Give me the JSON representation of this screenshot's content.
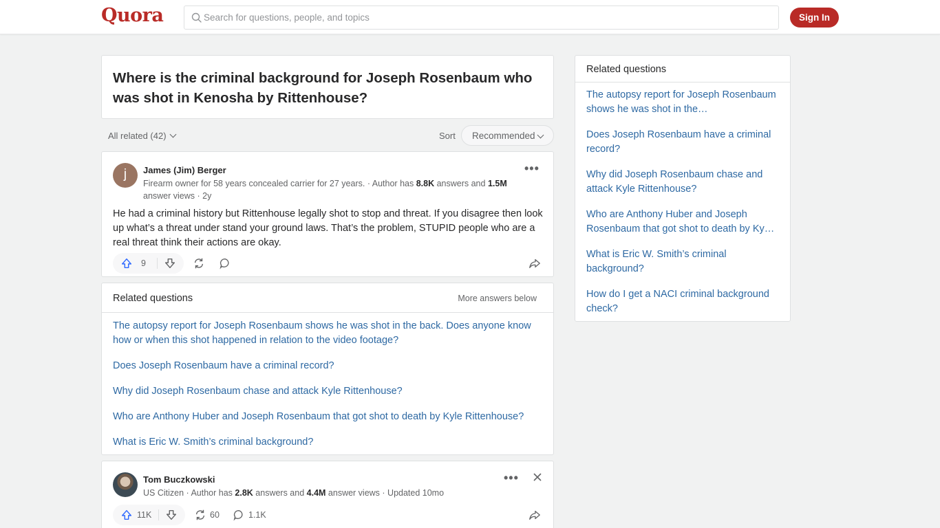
{
  "header": {
    "logo": "Quora",
    "search_placeholder": "Search for questions, people, and topics",
    "signin_label": "Sign In"
  },
  "question": {
    "title": "Where is the criminal background for Joseph Rosenbaum who was shot in Kenosha by Rittenhouse?"
  },
  "controls": {
    "all_related": "All related (42)",
    "sort_label": "Sort",
    "sort_value": "Recommended"
  },
  "answers": [
    {
      "author": "James (Jim) Berger",
      "cred_prefix": "Firearm owner for 58 years concealed carrier for 27 years. · Author has ",
      "answers_count": "8.8K",
      "cred_mid": " answers and ",
      "views_count": "1.5M",
      "cred_suffix": " answer views · 2y",
      "text": "He had a criminal history but Rittenhouse legally shot to stop and threat. If you disagree then look up what’s a threat under stand your ground laws. That’s the problem, STUPID people who are a real threat think their actions are okay.",
      "upvotes": "9",
      "shares": "",
      "comments": ""
    },
    {
      "author": "Tom Buczkowski",
      "cred_prefix": "US Citizen · Author has ",
      "answers_count": "2.8K",
      "cred_mid": " answers and ",
      "views_count": "4.4M",
      "cred_suffix": " answer views · Updated 10mo",
      "upvotes": "11K",
      "shares": "60",
      "comments": "1.1K"
    }
  ],
  "related_inline": {
    "title": "Related questions",
    "more_below": "More answers below",
    "items": [
      "The autopsy report for Joseph Rosenbaum shows he was shot in the back. Does anyone know how or when this shot happened in relation to the video footage?",
      "Does Joseph Rosenbaum have a criminal record?",
      "Why did Joseph Rosenbaum chase and attack Kyle Rittenhouse?",
      "Who are Anthony Huber and Joseph Rosenbaum that got shot to death by Kyle Rittenhouse?",
      "What is Eric W. Smith’s criminal background?"
    ]
  },
  "related_sidebar": {
    "title": "Related questions",
    "items": [
      "The autopsy report for Joseph Rosenbaum shows he was shot in the…",
      "Does Joseph Rosenbaum have a criminal record?",
      "Why did Joseph Rosenbaum chase and attack Kyle Rittenhouse?",
      "Who are Anthony Huber and Joseph Rosenbaum that got shot to death by Ky…",
      "What is Eric W. Smith’s criminal background?",
      "How do I get a NACI criminal background check?"
    ]
  },
  "colors": {
    "brand": "#b92b27",
    "link": "#2e69a3",
    "upvote": "#2e69ff"
  }
}
